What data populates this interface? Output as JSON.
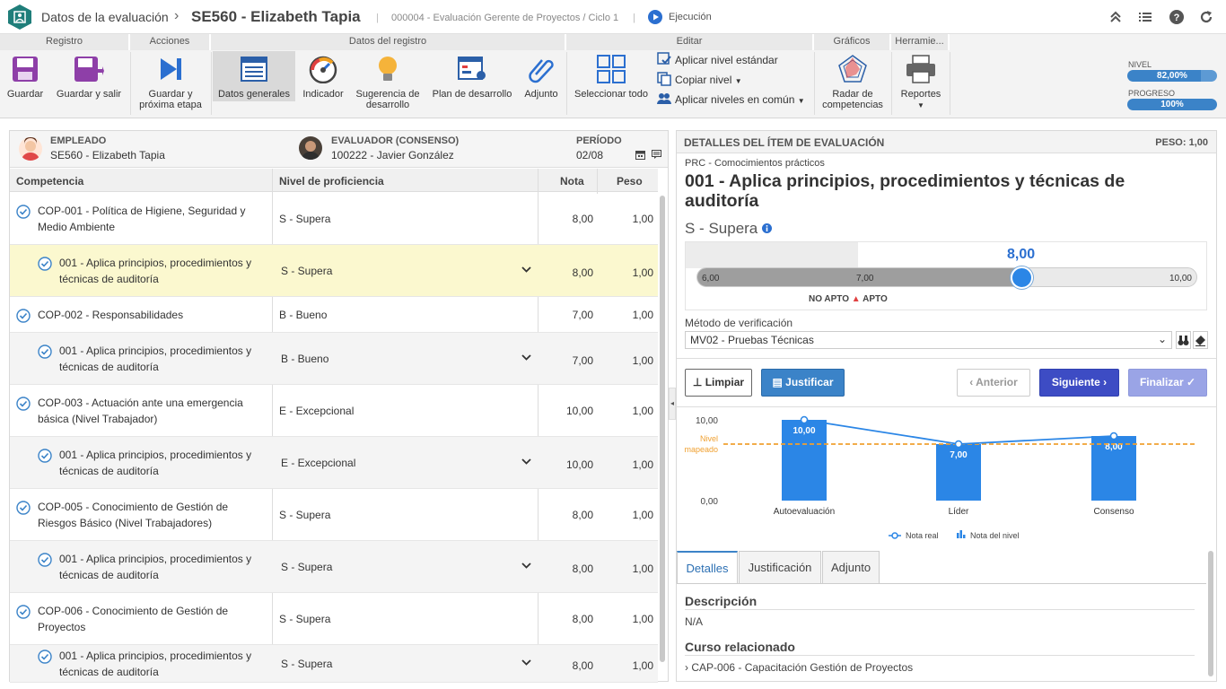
{
  "header": {
    "breadcrumb": "Datos de la evaluación",
    "title": "SE560 - Elizabeth Tapia",
    "subtitle": "000004 - Evaluación Gerente de Proyectos / Ciclo 1",
    "status": "Ejecución"
  },
  "ribbon": {
    "groups": {
      "registro": "Registro",
      "acciones": "Acciones",
      "datos": "Datos del registro",
      "editar": "Editar",
      "graficos": "Gráficos",
      "herramientas": "Herramie..."
    },
    "guardar": "Guardar",
    "guardar_salir": "Guardar y salir",
    "guardar_prox_1": "Guardar y",
    "guardar_prox_2": "próxima etapa",
    "datos_generales": "Datos generales",
    "indicador": "Indicador",
    "sugerencia_1": "Sugerencia de",
    "sugerencia_2": "desarrollo",
    "plan": "Plan de desarrollo",
    "adjunto": "Adjunto",
    "seleccionar_todo": "Seleccionar todo",
    "aplicar_nivel": "Aplicar nivel estándar",
    "copiar_nivel": "Copiar nivel",
    "aplicar_comun": "Aplicar niveles en común",
    "radar_1": "Radar de",
    "radar_2": "competencias",
    "reportes": "Reportes",
    "nivel_label": "NIVEL",
    "nivel_value": "82,00%",
    "nivel_pct": 82,
    "progreso_label": "PROGRESO",
    "progreso_value": "100%",
    "progreso_pct": 100
  },
  "employee": {
    "emp_label": "EMPLEADO",
    "emp_value": "SE560 - Elizabeth Tapia",
    "eval_label": "EVALUADOR (CONSENSO)",
    "eval_value": "100222 - Javier González",
    "period_label": "PERÍODO",
    "period_value": "02/08"
  },
  "grid": {
    "headers": {
      "competencia": "Competencia",
      "nivel": "Nivel de proficiencia",
      "nota": "Nota",
      "peso": "Peso"
    },
    "rows": [
      {
        "l1": "COP-001 - Política de Higiene, Seguridad y",
        "l2": "Medio Ambiente",
        "nivel": "S - Supera",
        "nota": "8,00",
        "peso": "1,00"
      },
      {
        "l1": "001 - Aplica principios, procedimientos y",
        "l2": "técnicas de auditoría",
        "nivel": "S - Supera",
        "nota": "8,00",
        "peso": "1,00"
      },
      {
        "l1": "COP-002 - Responsabilidades",
        "l2": "",
        "nivel": "B - Bueno",
        "nota": "7,00",
        "peso": "1,00"
      },
      {
        "l1": "001 - Aplica principios, procedimientos y",
        "l2": "técnicas de auditoría",
        "nivel": "B - Bueno",
        "nota": "7,00",
        "peso": "1,00"
      },
      {
        "l1": "COP-003 - Actuación ante una emergencia",
        "l2": "básica (Nivel Trabajador)",
        "nivel": "E - Excepcional",
        "nota": "10,00",
        "peso": "1,00"
      },
      {
        "l1": "001 - Aplica principios, procedimientos y",
        "l2": "técnicas de auditoría",
        "nivel": "E - Excepcional",
        "nota": "10,00",
        "peso": "1,00"
      },
      {
        "l1": "COP-005 - Conocimiento de Gestión de",
        "l2": "Riesgos Básico (Nivel Trabajadores)",
        "nivel": "S - Supera",
        "nota": "8,00",
        "peso": "1,00"
      },
      {
        "l1": "001 - Aplica principios, procedimientos y",
        "l2": "técnicas de auditoría",
        "nivel": "S - Supera",
        "nota": "8,00",
        "peso": "1,00"
      },
      {
        "l1": "COP-006 - Conocimiento de Gestión de",
        "l2": "Proyectos",
        "nivel": "S - Supera",
        "nota": "8,00",
        "peso": "1,00"
      },
      {
        "l1": "001 - Aplica principios, procedimientos y",
        "l2": "técnicas de auditoría",
        "nivel": "S - Supera",
        "nota": "8,00",
        "peso": "1,00"
      }
    ]
  },
  "details": {
    "head": "DETALLES DEL ÍTEM DE EVALUACIÓN",
    "peso": "PESO: 1,00",
    "category": "PRC - Comocimientos prácticos",
    "title_1": "001 - Aplica principios, procedimientos y técnicas de",
    "title_2": "auditoría",
    "level": "S - Supera",
    "score": "8,00",
    "slider_min": "6,00",
    "slider_mid": "7,00",
    "slider_max": "10,00",
    "no_apto": "NO APTO",
    "apto": "APTO",
    "method_label": "Método de verificación",
    "method_value": "MV02 - Pruebas Técnicas",
    "btn_limpiar": "Limpiar",
    "btn_justificar": "Justificar",
    "btn_anterior": "Anterior",
    "btn_siguiente": "Siguiente",
    "btn_finalizar": "Finalizar",
    "tabs": [
      "Detalles",
      "Justificación",
      "Adjunto"
    ],
    "desc_label": "Descripción",
    "desc_value": "N/A",
    "curso_label": "Curso relacionado",
    "curso_value": "CAP-006 - Capacitación Gestión de Proyectos"
  },
  "chart_data": {
    "type": "bar",
    "categories": [
      "Autoevaluación",
      "Líder",
      "Consenso"
    ],
    "series": [
      {
        "name": "Nota del nivel",
        "type": "bar",
        "values": [
          10.0,
          7.0,
          8.0
        ],
        "labels": [
          "10,00",
          "7,00",
          "8,00"
        ]
      },
      {
        "name": "Nota real",
        "type": "line",
        "values": [
          10.0,
          7.0,
          8.0
        ]
      }
    ],
    "reference_line": {
      "label_1": "Nivel",
      "label_2": "mapeado",
      "value": 7.0
    },
    "yticks": [
      "10,00",
      "0,00"
    ],
    "ylim": [
      0,
      10
    ],
    "legend_position": "bottom",
    "colors": {
      "bar": "#2b86e6",
      "line": "#2b86e6",
      "ref": "#f0a030"
    }
  }
}
